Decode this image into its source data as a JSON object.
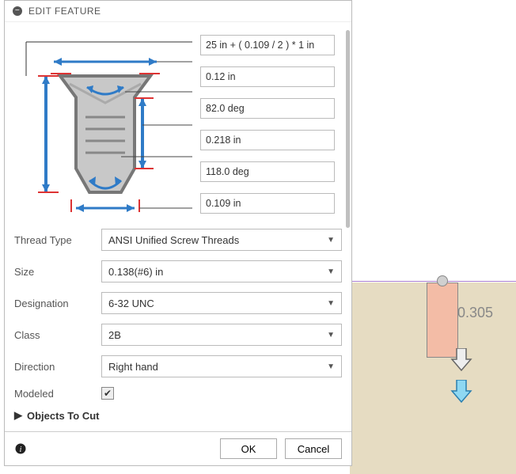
{
  "dialog": {
    "title": "EDIT FEATURE",
    "dims": {
      "d1": "25 in + ( 0.109 / 2 ) * 1 in",
      "d2": "0.12 in",
      "d3": "82.0 deg",
      "d4": "0.218 in",
      "d5": "118.0 deg",
      "d6": "0.109 in"
    },
    "fields": {
      "thread_type": {
        "label": "Thread Type",
        "value": "ANSI Unified Screw Threads"
      },
      "size": {
        "label": "Size",
        "value": "0.138(#6) in"
      },
      "designation": {
        "label": "Designation",
        "value": "6-32 UNC"
      },
      "class": {
        "label": "Class",
        "value": "2B"
      },
      "direction": {
        "label": "Direction",
        "value": "Right hand"
      },
      "modeled": {
        "label": "Modeled",
        "checked": true
      }
    },
    "objects_section": "Objects To Cut",
    "buttons": {
      "ok": "OK",
      "cancel": "Cancel"
    }
  },
  "canvas": {
    "dim_label": "0.305"
  }
}
